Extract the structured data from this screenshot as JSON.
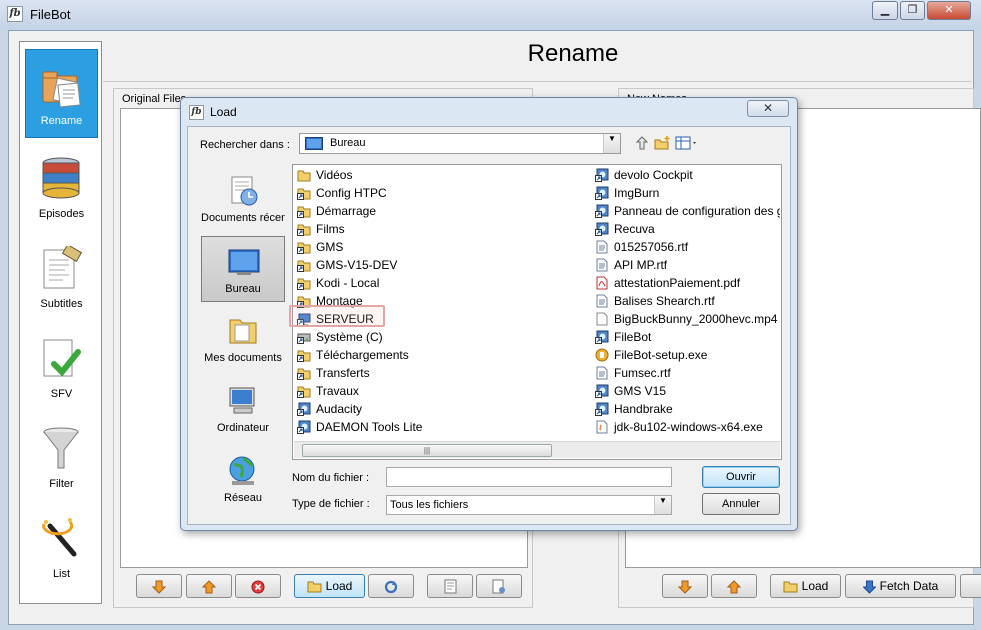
{
  "window": {
    "title": "FileBot",
    "logo": "fb",
    "minimize": "▁",
    "maximize": "❐",
    "close": "✕"
  },
  "header": {
    "title": "Rename"
  },
  "sidebar": {
    "items": [
      {
        "label": "Rename",
        "icon": "rename-folder-icon",
        "selected": true
      },
      {
        "label": "Episodes",
        "icon": "database-icon"
      },
      {
        "label": "Subtitles",
        "icon": "subtitles-icon"
      },
      {
        "label": "SFV",
        "icon": "checkmark-document-icon"
      },
      {
        "label": "Filter",
        "icon": "funnel-icon"
      },
      {
        "label": "List",
        "icon": "magic-wand-icon"
      }
    ]
  },
  "panels": {
    "original_label": "Original Files",
    "new_label": "New Names",
    "left_toolbar": {
      "load": "Load"
    },
    "right_toolbar": {
      "load": "Load",
      "fetch": "Fetch Data"
    }
  },
  "dialog": {
    "logo": "fb",
    "title": "Load",
    "close": "✕",
    "look_in_label": "Rechercher dans :",
    "look_in_value": "Bureau",
    "places": [
      {
        "label": "Documents récents",
        "icon": "recent-documents-icon"
      },
      {
        "label": "Bureau",
        "icon": "desktop-icon",
        "selected": true
      },
      {
        "label": "Mes documents",
        "icon": "my-documents-folder-icon"
      },
      {
        "label": "Ordinateur",
        "icon": "computer-icon"
      },
      {
        "label": "Réseau",
        "icon": "network-globe-icon"
      }
    ],
    "files_col1": [
      {
        "name": "Vidéos",
        "type": "folder"
      },
      {
        "name": "Config HTPC",
        "type": "folder-shortcut"
      },
      {
        "name": "Démarrage",
        "type": "folder-shortcut"
      },
      {
        "name": "Films",
        "type": "folder-shortcut"
      },
      {
        "name": "GMS",
        "type": "folder-shortcut"
      },
      {
        "name": "GMS-V15-DEV",
        "type": "folder-shortcut"
      },
      {
        "name": "Kodi - Local",
        "type": "folder-shortcut"
      },
      {
        "name": "Montage",
        "type": "folder-shortcut"
      },
      {
        "name": "SERVEUR",
        "type": "network-shortcut",
        "highlighted": true
      },
      {
        "name": "Système (C)",
        "type": "drive-shortcut"
      },
      {
        "name": "Téléchargements",
        "type": "folder-shortcut"
      },
      {
        "name": "Transferts",
        "type": "folder-shortcut"
      },
      {
        "name": "Travaux",
        "type": "folder-shortcut"
      },
      {
        "name": "Audacity",
        "type": "app-shortcut"
      },
      {
        "name": "DAEMON Tools Lite",
        "type": "app-shortcut"
      }
    ],
    "files_col2": [
      {
        "name": "devolo Cockpit",
        "type": "app-shortcut"
      },
      {
        "name": "ImgBurn",
        "type": "app-shortcut"
      },
      {
        "name": "Panneau de configuration des g",
        "type": "app-shortcut"
      },
      {
        "name": "Recuva",
        "type": "app-shortcut"
      },
      {
        "name": "015257056.rtf",
        "type": "document"
      },
      {
        "name": "API MP.rtf",
        "type": "document"
      },
      {
        "name": "attestationPaiement.pdf",
        "type": "pdf"
      },
      {
        "name": "Balises Shearch.rtf",
        "type": "document"
      },
      {
        "name": "BigBuckBunny_2000hevc.mp4",
        "type": "blank-file"
      },
      {
        "name": "FileBot",
        "type": "app-shortcut"
      },
      {
        "name": "FileBot-setup.exe",
        "type": "installer"
      },
      {
        "name": "Fumsec.rtf",
        "type": "document"
      },
      {
        "name": "GMS V15",
        "type": "app-shortcut"
      },
      {
        "name": "Handbrake",
        "type": "app-shortcut"
      },
      {
        "name": "jdk-8u102-windows-x64.exe",
        "type": "java-installer"
      }
    ],
    "file_name_label": "Nom du fichier :",
    "file_name_value": "",
    "file_type_label": "Type de fichier :",
    "file_type_value": "Tous les fichiers",
    "open_button": "Ouvrir",
    "cancel_button": "Annuler",
    "scroll_grip": "|||"
  }
}
